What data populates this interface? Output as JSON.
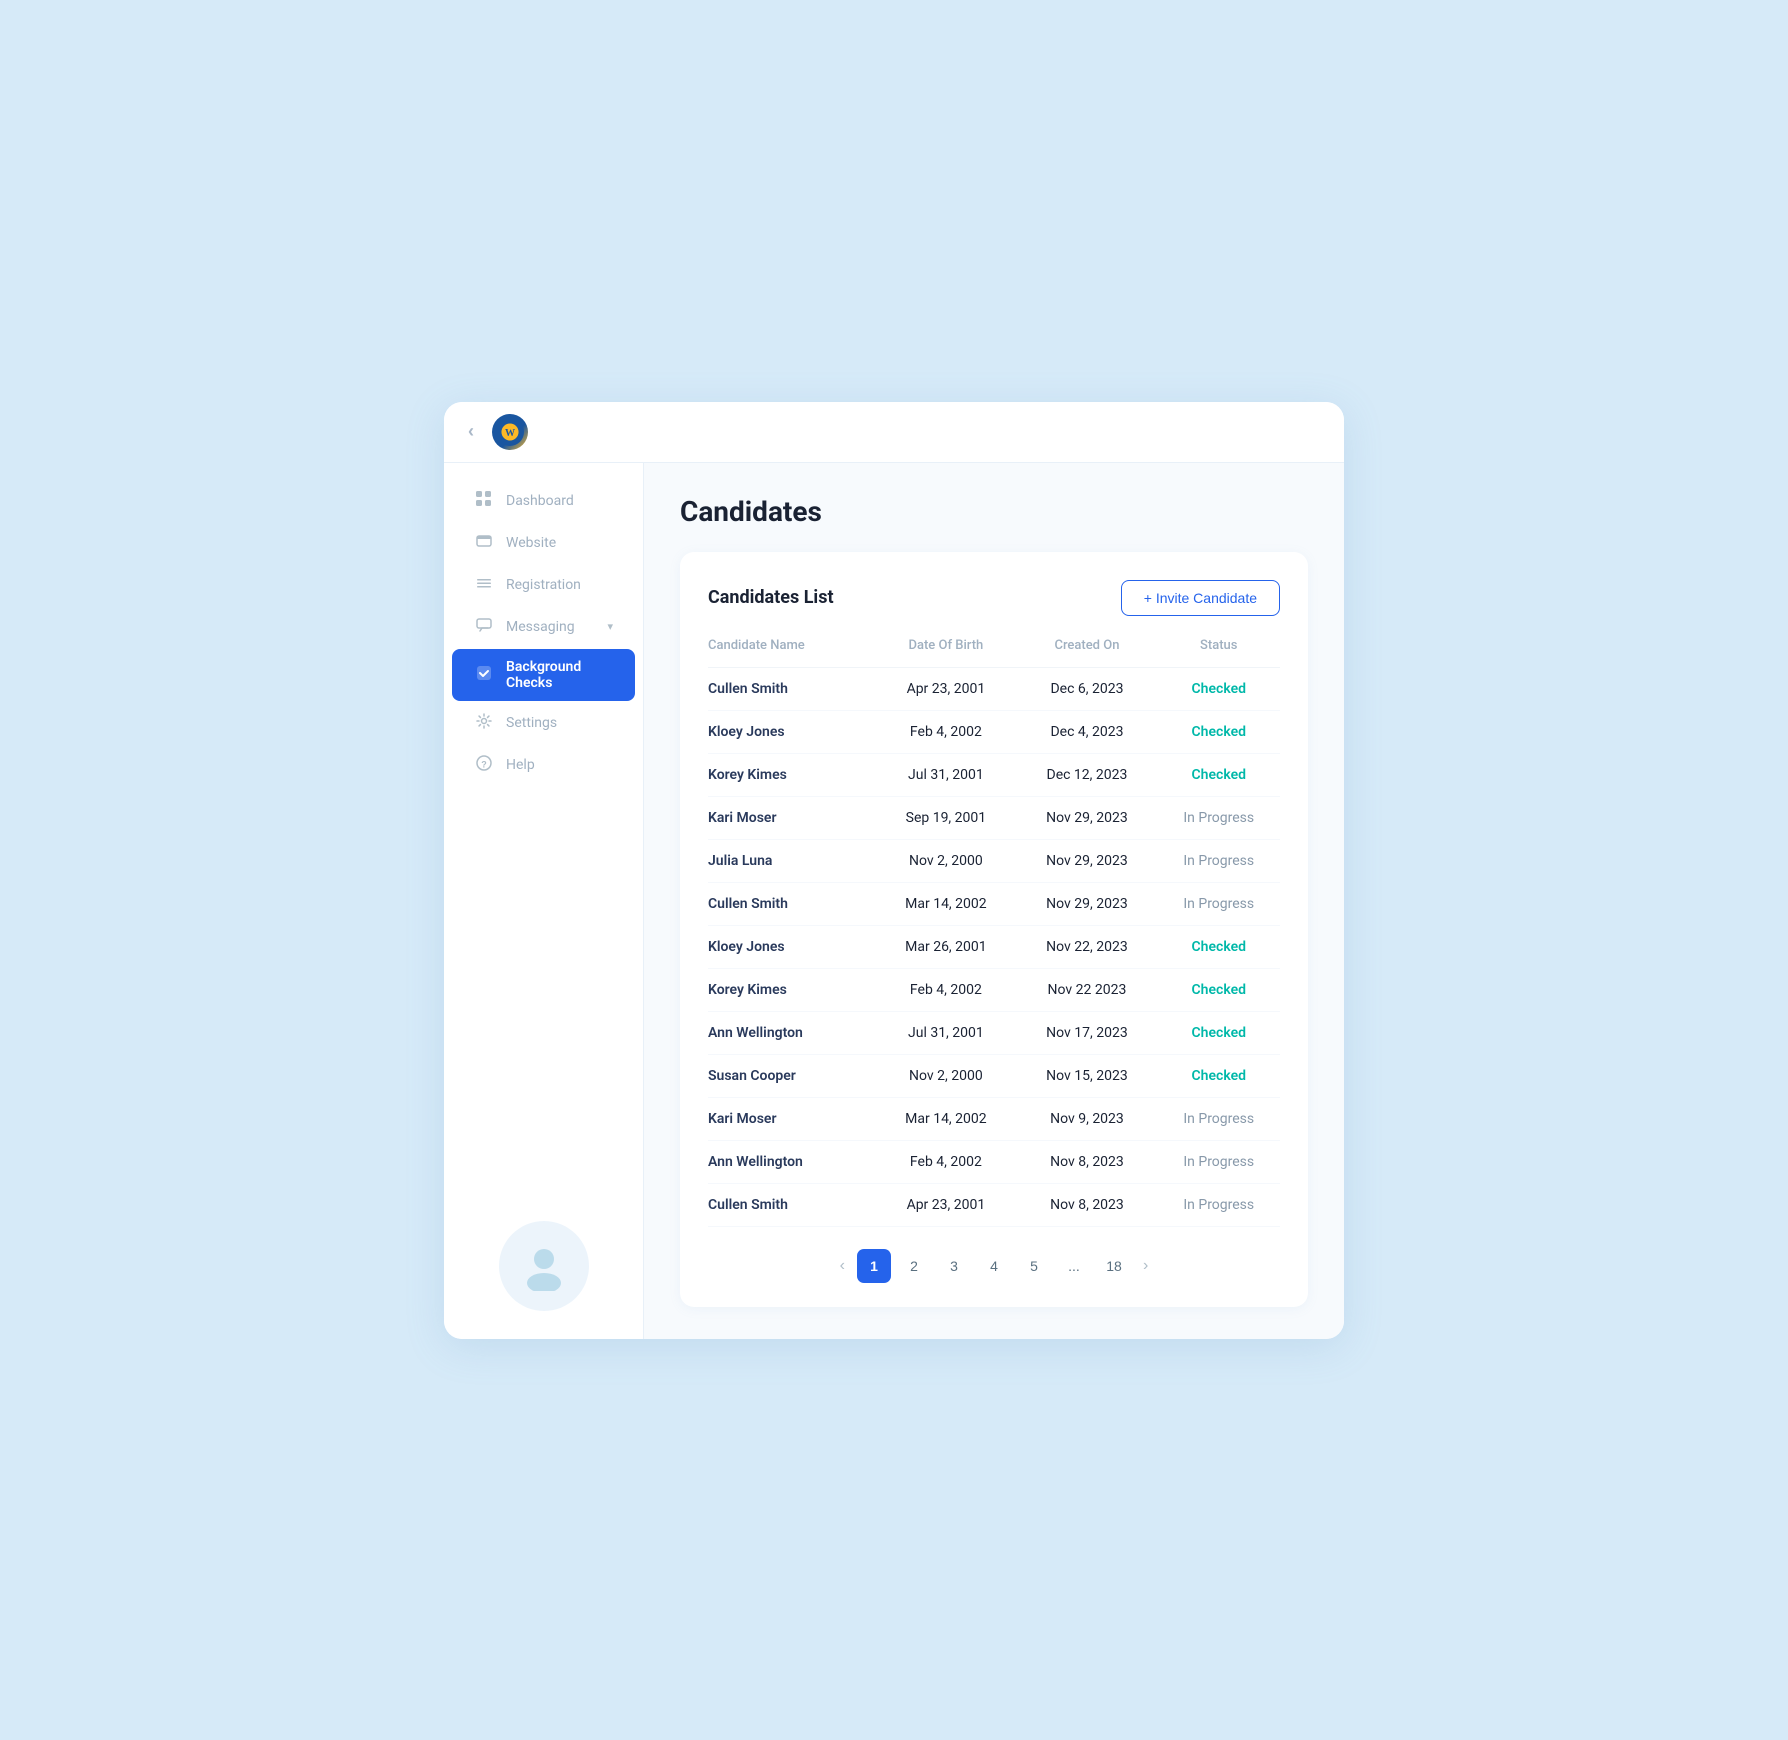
{
  "topbar": {
    "collapse_icon": "‹",
    "logo_alt": "Golden State Warriors"
  },
  "sidebar": {
    "items": [
      {
        "id": "dashboard",
        "label": "Dashboard",
        "icon": "⊞",
        "active": false
      },
      {
        "id": "website",
        "label": "Website",
        "icon": "🖥",
        "active": false
      },
      {
        "id": "registration",
        "label": "Registration",
        "icon": "≡",
        "active": false
      },
      {
        "id": "messaging",
        "label": "Messaging",
        "icon": "💬",
        "active": false,
        "chevron": "▾"
      },
      {
        "id": "background-checks",
        "label": "Background Checks",
        "icon": "✔",
        "active": true
      },
      {
        "id": "settings",
        "label": "Settings",
        "icon": "⚙",
        "active": false
      },
      {
        "id": "help",
        "label": "Help",
        "icon": "?",
        "active": false
      }
    ]
  },
  "page": {
    "title": "Candidates",
    "card": {
      "title": "Candidates List",
      "invite_button": "+ Invite Candidate"
    },
    "table": {
      "headers": [
        "Candidate Name",
        "Date Of Birth",
        "Created On",
        "Status"
      ],
      "rows": [
        {
          "name": "Cullen Smith",
          "dob": "Apr 23, 2001",
          "created": "Dec 6, 2023",
          "status": "Checked"
        },
        {
          "name": "Kloey Jones",
          "dob": "Feb 4, 2002",
          "created": "Dec 4, 2023",
          "status": "Checked"
        },
        {
          "name": "Korey Kimes",
          "dob": "Jul 31, 2001",
          "created": "Dec 12, 2023",
          "status": "Checked"
        },
        {
          "name": "Kari Moser",
          "dob": "Sep 19, 2001",
          "created": "Nov 29, 2023",
          "status": "In Progress"
        },
        {
          "name": "Julia Luna",
          "dob": "Nov 2, 2000",
          "created": "Nov 29, 2023",
          "status": "In Progress"
        },
        {
          "name": "Cullen Smith",
          "dob": "Mar 14, 2002",
          "created": "Nov 29, 2023",
          "status": "In Progress"
        },
        {
          "name": "Kloey Jones",
          "dob": "Mar 26, 2001",
          "created": "Nov 22, 2023",
          "status": "Checked"
        },
        {
          "name": "Korey Kimes",
          "dob": "Feb 4, 2002",
          "created": "Nov 22 2023",
          "status": "Checked"
        },
        {
          "name": "Ann Wellington",
          "dob": "Jul 31, 2001",
          "created": "Nov 17, 2023",
          "status": "Checked"
        },
        {
          "name": "Susan Cooper",
          "dob": "Nov 2, 2000",
          "created": "Nov 15, 2023",
          "status": "Checked"
        },
        {
          "name": "Kari Moser",
          "dob": "Mar 14, 2002",
          "created": "Nov 9, 2023",
          "status": "In Progress"
        },
        {
          "name": "Ann Wellington",
          "dob": "Feb 4, 2002",
          "created": "Nov 8, 2023",
          "status": "In Progress"
        },
        {
          "name": "Cullen Smith",
          "dob": "Apr 23, 2001",
          "created": "Nov 8, 2023",
          "status": "In Progress"
        }
      ]
    },
    "pagination": {
      "pages": [
        "1",
        "2",
        "3",
        "4",
        "5",
        "...",
        "18"
      ],
      "active_page": "1",
      "prev_icon": "‹",
      "next_icon": "›"
    }
  }
}
